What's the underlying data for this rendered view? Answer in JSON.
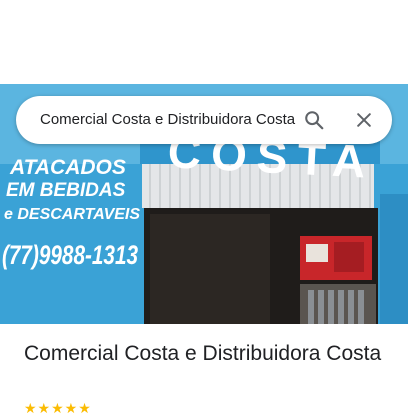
{
  "search": {
    "query": "Comercial Costa e Distribuidora Costa",
    "search_icon": "search-icon",
    "close_icon": "close-icon"
  },
  "photo": {
    "sign_atacados": "ATACADOS",
    "sign_em_bebidas": "EM BEBIDAS",
    "sign_descartaveis": "e DESCARTAVEIS",
    "sign_phone": "(77)9988-1313",
    "sign_costa": "COSTA"
  },
  "place": {
    "name": "Comercial Costa e Distribuidora Costa",
    "rating_stars": "★★★★★"
  },
  "colors": {
    "wall_blue": "#3aa2d6",
    "sign_white": "#ffffff",
    "text": "#202124"
  }
}
